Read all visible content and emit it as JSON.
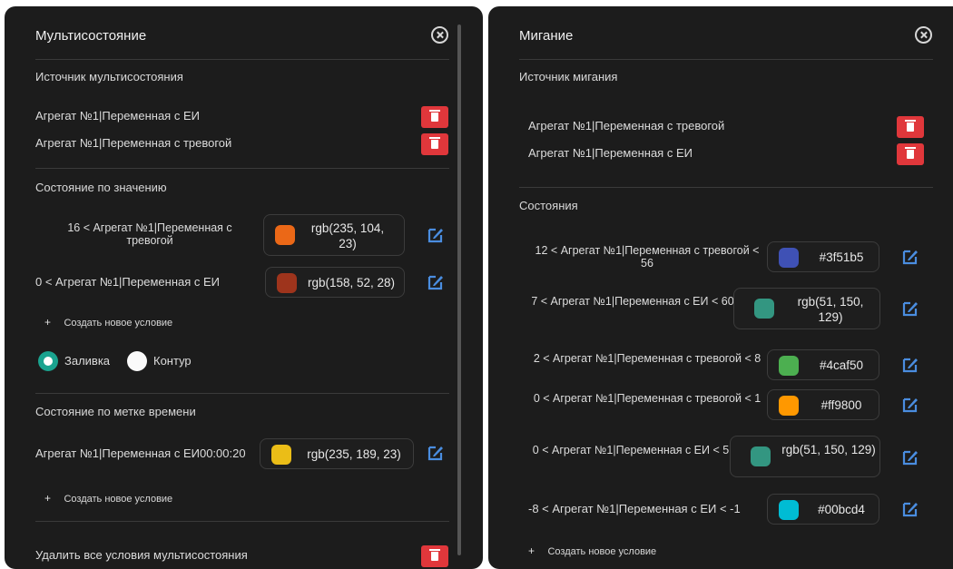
{
  "left": {
    "title": "Мультисостояние",
    "source_header": "Источник мультисостояния",
    "sources": [
      "Агрегат №1|Переменная с ЕИ",
      "Агрегат №1|Переменная с тревогой"
    ],
    "by_value_header": "Состояние по значению",
    "value_conditions": [
      {
        "label": "16 < Агрегат №1|Переменная с тревогой",
        "color_text": "rgb(235, 104, 23)",
        "color": "#eb6817"
      },
      {
        "label": "0 < Агрегат №1|Переменная с ЕИ",
        "color_text": "rgb(158, 52, 28)",
        "color": "#9e341c"
      }
    ],
    "add_condition": "Создать новое условие",
    "plus": "+",
    "fill_label": "Заливка",
    "outline_label": "Контур",
    "by_time_header": "Состояние по метке времени",
    "time_condition": {
      "label": "Агрегат №1|Переменная с ЕИ00:00:20",
      "color_text": "rgb(235, 189, 23)",
      "color": "#ebbd17"
    },
    "delete_all": "Удалить все условия мультисостояния"
  },
  "right": {
    "title": "Мигание",
    "source_header": "Источник мигания",
    "sources": [
      "Агрегат №1|Переменная с тревогой",
      "Агрегат №1|Переменная с ЕИ"
    ],
    "states_header": "Состояния",
    "states": [
      {
        "label": "12 < Агрегат №1|Переменная с тревогой < 56",
        "color_text": "#3f51b5",
        "color": "#3f51b5"
      },
      {
        "label": "7 < Агрегат №1|Переменная с ЕИ < 60",
        "color_text": "rgb(51, 150, 129)",
        "color": "#339681"
      },
      {
        "label": "2 < Агрегат №1|Переменная с тревогой < 8",
        "color_text": "#4caf50",
        "color": "#4caf50"
      },
      {
        "label": "0 < Агрегат №1|Переменная с тревогой < 1",
        "color_text": "#ff9800",
        "color": "#ff9800"
      },
      {
        "label": "0 < Агрегат №1|Переменная с ЕИ < 5",
        "color_text": "rgb(51, 150, 129)",
        "color": "#339681"
      },
      {
        "label": "-8 < Агрегат №1|Переменная с ЕИ < -1",
        "color_text": "#00bcd4",
        "color": "#00bcd4"
      }
    ],
    "add_condition": "Создать новое условие",
    "plus": "+"
  },
  "colors": {
    "delete": "#e0373b",
    "edit": "#4a8de0",
    "radio_on": "#1aa38f",
    "panel_bg": "#1c1c1c"
  },
  "icons": [
    "close-icon",
    "trash-icon",
    "edit-icon"
  ]
}
